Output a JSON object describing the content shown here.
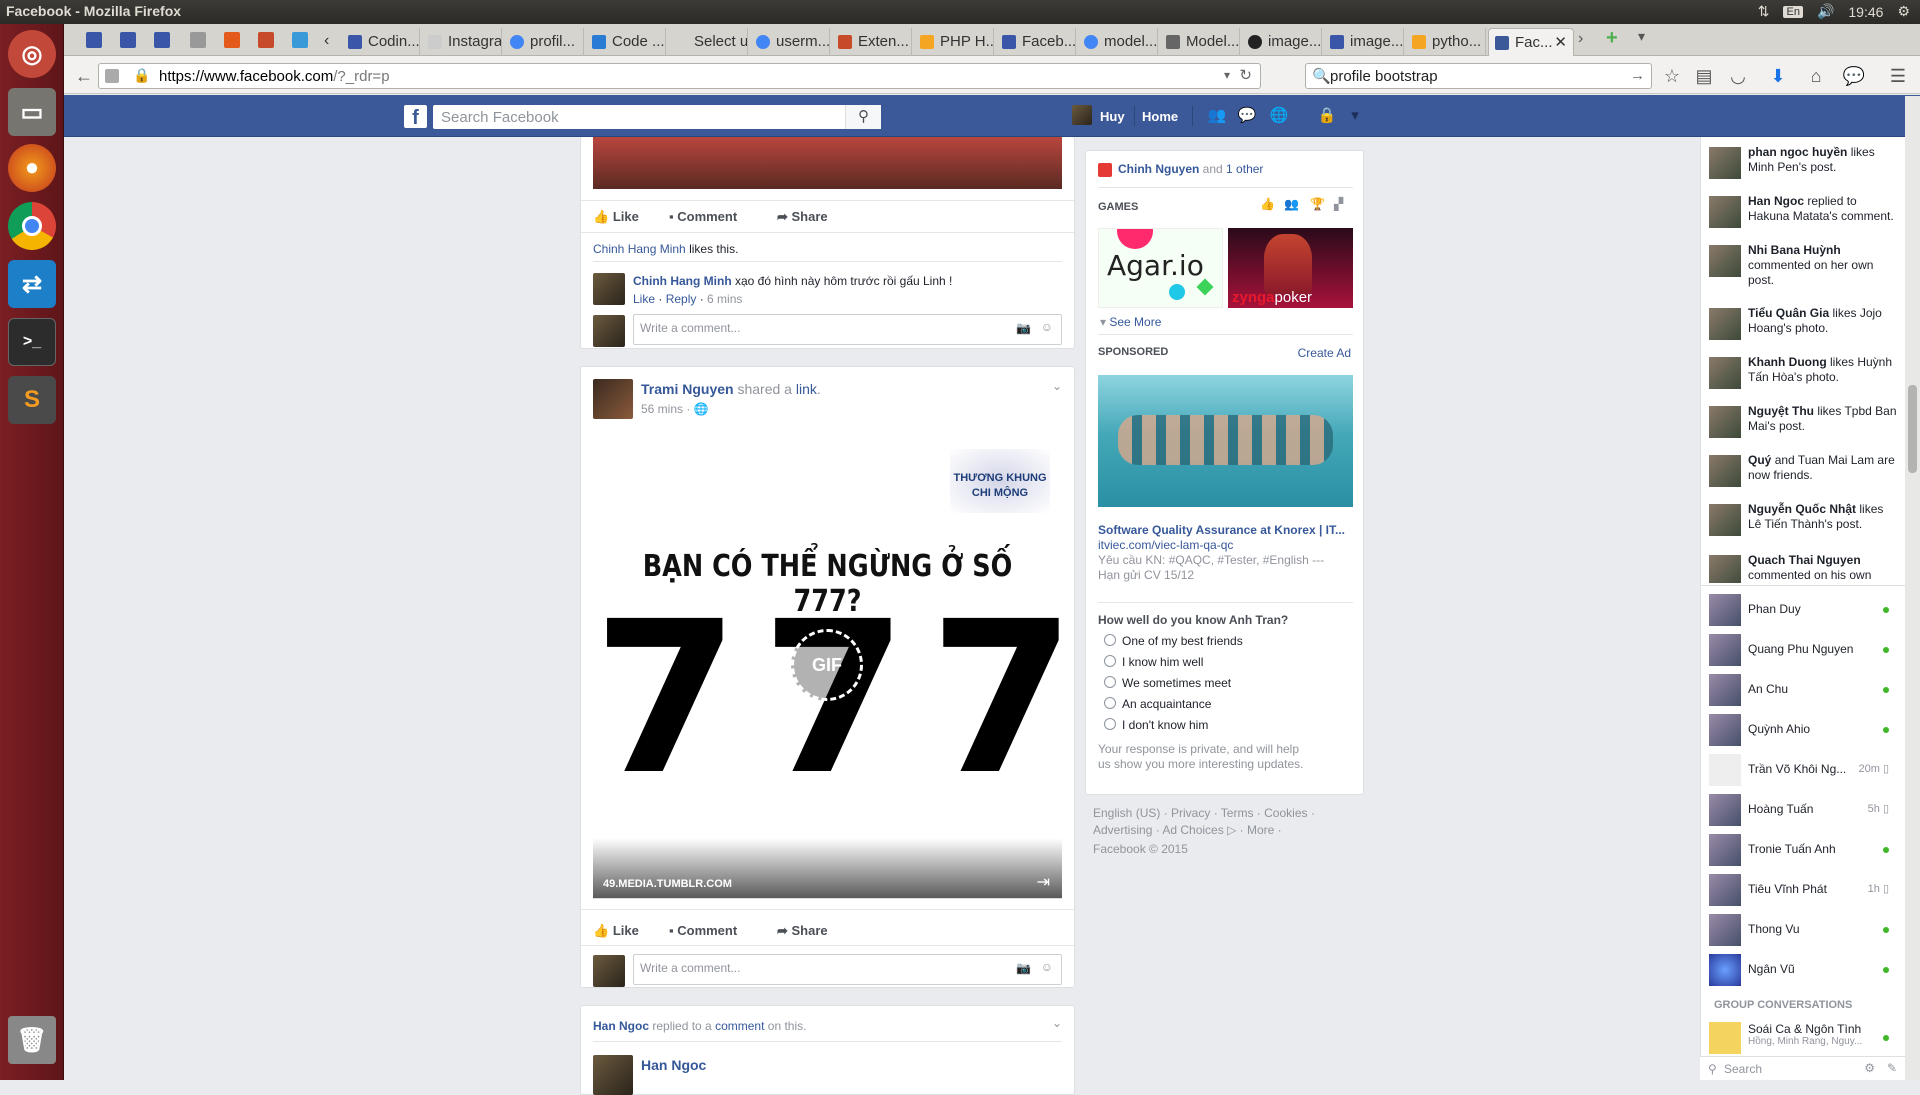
{
  "os": {
    "window_title": "Facebook - Mozilla Firefox",
    "lang": "En",
    "time": "19:46"
  },
  "tabs": [
    "Codin...",
    "Instagra...",
    "profil...",
    "Code ...",
    "Select us...",
    "userm...",
    "Exten...",
    "PHP H...",
    "Faceb...",
    "model...",
    "Model...",
    "image...",
    "image...",
    "pytho...",
    "Fac..."
  ],
  "browser": {
    "url_host": "https://www.facebook.com",
    "url_path": "/?_rdr=p",
    "search_value": "profile bootstrap"
  },
  "header": {
    "search_placeholder": "Search Facebook",
    "user": "Huy",
    "home": "Home"
  },
  "post1": {
    "actions": {
      "like": "Like",
      "comment": "Comment",
      "share": "Share"
    },
    "likers": "Chinh Hang Minh",
    "likers_suffix": "likes this.",
    "comment_author": "Chinh Hang Minh",
    "comment_text": "xạo đó hình này hôm trước rồi gấu Linh !",
    "comment_like": "Like",
    "comment_reply": "Reply",
    "comment_time": "6 mins",
    "write_placeholder": "Write a comment..."
  },
  "post2": {
    "author": "Trami Nguyen",
    "shared": "shared a",
    "link_word": "link",
    "time": "56 mins",
    "gif_caption": "BẠN CÓ THỂ NGỪNG Ở SỐ 777?",
    "gif_number": "777",
    "gif_badge": "GIF",
    "logo_text_1": "THƯƠNG KHUNG",
    "logo_text_2": "CHI MỘNG",
    "source": "49.MEDIA.TUMBLR.COM",
    "actions": {
      "like": "Like",
      "comment": "Comment",
      "share": "Share"
    },
    "write_placeholder": "Write a comment..."
  },
  "post3": {
    "notice_author": "Han Ngoc",
    "notice_mid": "replied to a",
    "notice_link": "comment",
    "notice_end": "on this.",
    "author": "Han Ngoc"
  },
  "right_col": {
    "friend_line_name": "Chinh Nguyen",
    "friend_line_mid": "and",
    "friend_line_other": "1 other",
    "games_label": "GAMES",
    "game1": "Agar.io",
    "game2_brand": "zynga",
    "game2": "poker",
    "see_more": "See More",
    "sponsored_label": "SPONSORED",
    "create_ad": "Create Ad",
    "ad_title": "Software Quality Assurance at Knorex | IT...",
    "ad_url": "itviec.com/viec-lam-qa-qc",
    "ad_desc": "Yêu cầu KN: #QAQC, #Tester, #English --- Hạn gửi CV 15/12",
    "poll_question": "How well do you know Anh Tran?",
    "poll_options": [
      "One of my best friends",
      "I know him well",
      "We sometimes meet",
      "An acquaintance",
      "I don't know him"
    ],
    "poll_note": "Your response is private, and will help us show you more interesting updates.",
    "footer_1": "English (US) · Privacy · Terms · Cookies ·",
    "footer_2": "Advertising · Ad Choices ▷ · More ·",
    "footer_3": "Facebook © 2015"
  },
  "ticker": [
    {
      "name": "phan ngoc huyền",
      "text": "likes Minh Pen's post."
    },
    {
      "name": "Han Ngoc",
      "text": "replied to Hakuna Matata's comment."
    },
    {
      "name": "Nhi Bana Huỳnh",
      "text": "commented on her own post."
    },
    {
      "name": "Tiểu Quân Gia",
      "text": "likes Jojo Hoang's photo."
    },
    {
      "name": "Khanh Duong",
      "text": "likes Huỳnh Tấn Hòa's photo."
    },
    {
      "name": "Nguyệt Thu",
      "text": "likes Tpbd Ban Mai's post."
    },
    {
      "name": "Quý",
      "text": "and Tuan Mai Lam are now friends."
    },
    {
      "name": "Nguyễn Quốc Nhật",
      "text": "likes Lê Tiến Thành's post."
    },
    {
      "name": "Quach Thai Nguyen",
      "text": "commented on his own"
    }
  ],
  "chat": [
    {
      "name": "Phan Duy",
      "status": ""
    },
    {
      "name": "Quang Phu Nguyen",
      "status": ""
    },
    {
      "name": "An Chu",
      "status": ""
    },
    {
      "name": "Quỳnh Ahio",
      "status": ""
    },
    {
      "name": "Trần Võ Khôi Ng...",
      "status": "20m"
    },
    {
      "name": "Hoàng Tuấn",
      "status": "5h"
    },
    {
      "name": "Tronie Tuấn Anh",
      "status": ""
    },
    {
      "name": "Tiêu Vĩnh Phát",
      "status": "1h"
    },
    {
      "name": "Thong Vu",
      "status": ""
    },
    {
      "name": "Ngân Vũ",
      "status": ""
    }
  ],
  "group_label": "GROUP CONVERSATIONS",
  "group": {
    "name": "Soái Ca & Ngôn Tình",
    "sub": "Hồng, Minh Rang, Nguy..."
  },
  "chat_search": "Search"
}
